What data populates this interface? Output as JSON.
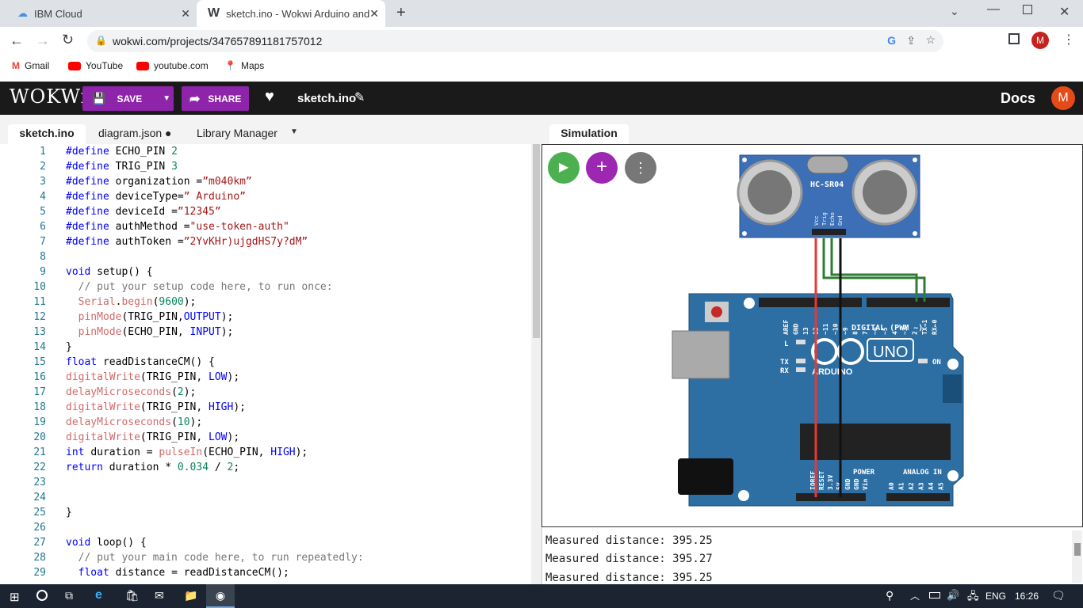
{
  "browser": {
    "tabs": [
      {
        "title": "IBM Cloud"
      },
      {
        "title": "sketch.ino - Wokwi Arduino and E"
      }
    ],
    "url": "wokwi.com/projects/347657891181757012",
    "profile_initial": "M",
    "bookmarks": [
      {
        "label": "Gmail"
      },
      {
        "label": "YouTube"
      },
      {
        "label": "youtube.com"
      },
      {
        "label": "Maps"
      }
    ]
  },
  "wokwi": {
    "logo": "WOKWi",
    "save_label": "SAVE",
    "share_label": "SHARE",
    "file_title": "sketch.ino",
    "docs_label": "Docs",
    "avatar_initial": "M"
  },
  "editor": {
    "tabs": [
      {
        "label": "sketch.ino"
      },
      {
        "label": "diagram.json ●"
      },
      {
        "label": "Library Manager"
      }
    ],
    "lines": [
      [
        {
          "t": "#define ",
          "c": "k"
        },
        {
          "t": "ECHO_PIN ",
          "c": ""
        },
        {
          "t": "2",
          "c": "n"
        }
      ],
      [
        {
          "t": "#define ",
          "c": "k"
        },
        {
          "t": "TRIG_PIN ",
          "c": ""
        },
        {
          "t": "3",
          "c": "n"
        }
      ],
      [
        {
          "t": "#define ",
          "c": "k"
        },
        {
          "t": "organization =",
          "c": ""
        },
        {
          "t": "”m040km”",
          "c": "s"
        }
      ],
      [
        {
          "t": "#define ",
          "c": "k"
        },
        {
          "t": "deviceType=",
          "c": ""
        },
        {
          "t": "” Arduino”",
          "c": "s"
        }
      ],
      [
        {
          "t": "#define ",
          "c": "k"
        },
        {
          "t": "deviceId =",
          "c": ""
        },
        {
          "t": "”12345”",
          "c": "s"
        }
      ],
      [
        {
          "t": "#define ",
          "c": "k"
        },
        {
          "t": "authMethod =",
          "c": ""
        },
        {
          "t": "\"use-token-auth\"",
          "c": "s"
        }
      ],
      [
        {
          "t": "#define ",
          "c": "k"
        },
        {
          "t": "authToken =",
          "c": ""
        },
        {
          "t": "”2YvKHr)ujgdHS7y?dM”",
          "c": "s"
        }
      ],
      [],
      [
        {
          "t": "void ",
          "c": "k"
        },
        {
          "t": "setup() {",
          "c": ""
        }
      ],
      [
        {
          "t": "  // put your setup code here, to run once:",
          "c": "c"
        }
      ],
      [
        {
          "t": "  Serial",
          "c": "f"
        },
        {
          "t": ".",
          "c": ""
        },
        {
          "t": "begin",
          "c": "f"
        },
        {
          "t": "(",
          "c": ""
        },
        {
          "t": "9600",
          "c": "n"
        },
        {
          "t": ");",
          "c": ""
        }
      ],
      [
        {
          "t": "  pinMode",
          "c": "f"
        },
        {
          "t": "(TRIG_PIN,",
          "c": ""
        },
        {
          "t": "OUTPUT",
          "c": "k"
        },
        {
          "t": ");",
          "c": ""
        }
      ],
      [
        {
          "t": "  pinMode",
          "c": "f"
        },
        {
          "t": "(ECHO_PIN, ",
          "c": ""
        },
        {
          "t": "INPUT",
          "c": "k"
        },
        {
          "t": ");",
          "c": ""
        }
      ],
      [
        {
          "t": "}",
          "c": ""
        }
      ],
      [
        {
          "t": "float ",
          "c": "k"
        },
        {
          "t": "readDistanceCM() {",
          "c": ""
        }
      ],
      [
        {
          "t": "digitalWrite",
          "c": "f"
        },
        {
          "t": "(TRIG_PIN, ",
          "c": ""
        },
        {
          "t": "LOW",
          "c": "k"
        },
        {
          "t": ");",
          "c": ""
        }
      ],
      [
        {
          "t": "delayMicroseconds",
          "c": "f"
        },
        {
          "t": "(",
          "c": ""
        },
        {
          "t": "2",
          "c": "n"
        },
        {
          "t": ");",
          "c": ""
        }
      ],
      [
        {
          "t": "digitalWrite",
          "c": "f"
        },
        {
          "t": "(TRIG_PIN, ",
          "c": ""
        },
        {
          "t": "HIGH",
          "c": "k"
        },
        {
          "t": ");",
          "c": ""
        }
      ],
      [
        {
          "t": "delayMicroseconds",
          "c": "f"
        },
        {
          "t": "(",
          "c": ""
        },
        {
          "t": "10",
          "c": "n"
        },
        {
          "t": ");",
          "c": ""
        }
      ],
      [
        {
          "t": "digitalWrite",
          "c": "f"
        },
        {
          "t": "(TRIG_PIN, ",
          "c": ""
        },
        {
          "t": "LOW",
          "c": "k"
        },
        {
          "t": ");",
          "c": ""
        }
      ],
      [
        {
          "t": "int ",
          "c": "k"
        },
        {
          "t": "duration = ",
          "c": ""
        },
        {
          "t": "pulseIn",
          "c": "f"
        },
        {
          "t": "(ECHO_PIN, ",
          "c": ""
        },
        {
          "t": "HIGH",
          "c": "k"
        },
        {
          "t": ");",
          "c": ""
        }
      ],
      [
        {
          "t": "return ",
          "c": "k"
        },
        {
          "t": "duration * ",
          "c": ""
        },
        {
          "t": "0.034",
          "c": "n"
        },
        {
          "t": " / ",
          "c": ""
        },
        {
          "t": "2",
          "c": "n"
        },
        {
          "t": ";",
          "c": ""
        }
      ],
      [],
      [],
      [
        {
          "t": "}",
          "c": ""
        }
      ],
      [],
      [
        {
          "t": "void ",
          "c": "k"
        },
        {
          "t": "loop() {",
          "c": ""
        }
      ],
      [
        {
          "t": "  // put your main code here, to run repeatedly:",
          "c": "c"
        }
      ],
      [
        {
          "t": "  float ",
          "c": "k"
        },
        {
          "t": "distance = readDistanceCM();",
          "c": ""
        }
      ]
    ]
  },
  "simulation": {
    "tab_label": "Simulation",
    "sensor_label": "HC-SR04",
    "sensor_pins": [
      "Vcc",
      "Trig",
      "Echo",
      "Gnd"
    ],
    "board_label": "UNO",
    "board_brand": "ARDUINO",
    "board_texts": [
      "AREF",
      "GND",
      "13",
      "12",
      "~11",
      "~10",
      "~9",
      "8",
      "7",
      "~6",
      "~5",
      "4",
      "~3",
      "2",
      "TX→1",
      "RX←0"
    ],
    "digital_label": "DIGITAL (PWM ~)",
    "power_label": "POWER",
    "analog_label": "ANALOG IN",
    "on_label": "ON",
    "l_label": "L",
    "tx_label": "TX",
    "rx_label": "RX",
    "power_pins": [
      "IOREF",
      "RESET",
      "3.3V",
      "5V",
      "GND",
      "GND",
      "Vin"
    ],
    "analog_pins": [
      "A0",
      "A1",
      "A2",
      "A3",
      "A4",
      "A5"
    ]
  },
  "serial": {
    "lines": [
      "Measured distance: 395.25",
      "Measured distance: 395.27",
      "Measured distance: 395.25"
    ]
  },
  "taskbar": {
    "lang": "ENG",
    "time": "16:26"
  }
}
